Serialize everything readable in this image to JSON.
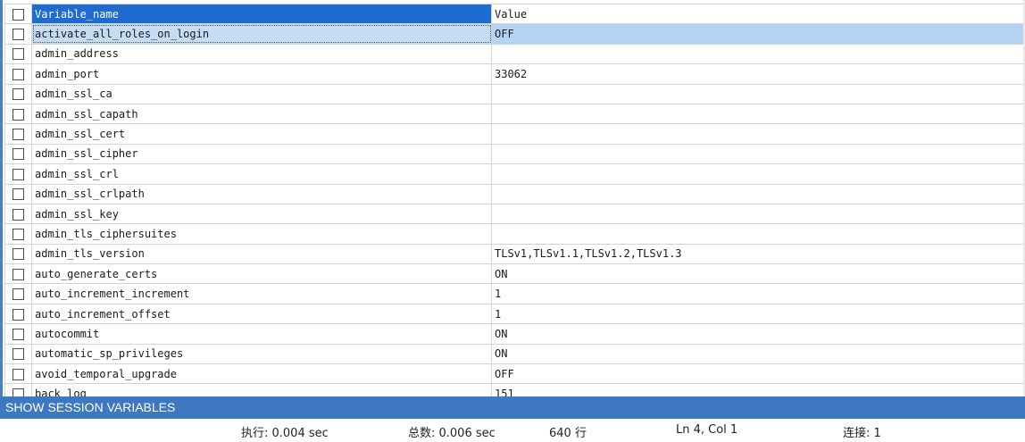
{
  "grid": {
    "header": {
      "name": "Variable_name",
      "value": "Value"
    },
    "selected_index": 0,
    "rows": [
      {
        "name": "activate_all_roles_on_login",
        "value": "OFF"
      },
      {
        "name": "admin_address",
        "value": ""
      },
      {
        "name": "admin_port",
        "value": "33062"
      },
      {
        "name": "admin_ssl_ca",
        "value": ""
      },
      {
        "name": "admin_ssl_capath",
        "value": ""
      },
      {
        "name": "admin_ssl_cert",
        "value": ""
      },
      {
        "name": "admin_ssl_cipher",
        "value": ""
      },
      {
        "name": "admin_ssl_crl",
        "value": ""
      },
      {
        "name": "admin_ssl_crlpath",
        "value": ""
      },
      {
        "name": "admin_ssl_key",
        "value": ""
      },
      {
        "name": "admin_tls_ciphersuites",
        "value": ""
      },
      {
        "name": "admin_tls_version",
        "value": "TLSv1,TLSv1.1,TLSv1.2,TLSv1.3"
      },
      {
        "name": "auto_generate_certs",
        "value": "ON"
      },
      {
        "name": "auto_increment_increment",
        "value": "1"
      },
      {
        "name": "auto_increment_offset",
        "value": "1"
      },
      {
        "name": "autocommit",
        "value": "ON"
      },
      {
        "name": "automatic_sp_privileges",
        "value": "ON"
      },
      {
        "name": "avoid_temporal_upgrade",
        "value": "OFF"
      },
      {
        "name": "back_log",
        "value": "151"
      }
    ]
  },
  "sql_bar": {
    "text": "SHOW SESSION VARIABLES"
  },
  "status": {
    "exec": "执行: 0.004 sec",
    "total": "总数: 0.006 sec",
    "rows": "640 行",
    "cursor": "Ln 4, Col 1",
    "connection": "连接: 1"
  },
  "colors": {
    "header_cell": "#1e6bd2",
    "selected_row": "#b5d3f3",
    "sql_bar": "#3d78c0"
  }
}
